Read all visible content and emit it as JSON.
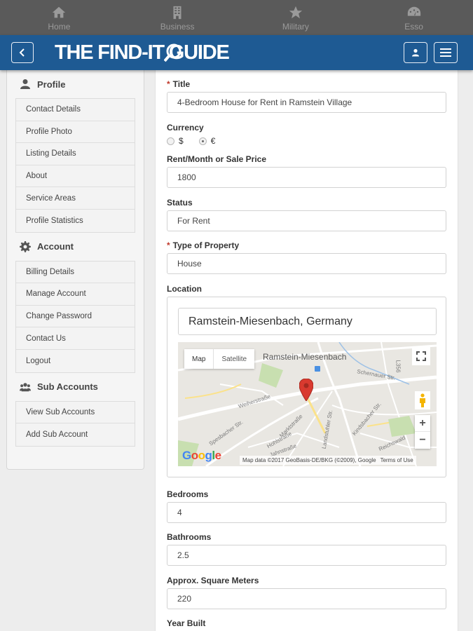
{
  "topnav": {
    "items": [
      {
        "label": "Home",
        "icon": "home-icon"
      },
      {
        "label": "Business",
        "icon": "building-icon"
      },
      {
        "label": "Military",
        "icon": "star-icon"
      },
      {
        "label": "Esso",
        "icon": "gauge-icon"
      }
    ]
  },
  "header": {
    "logo_text": "THE FIND-IT GUIDE",
    "brand_color": "#1e5a93"
  },
  "sidebar": {
    "sections": [
      {
        "title": "Profile",
        "icon": "user-icon",
        "items": [
          "Contact Details",
          "Profile Photo",
          "Listing Details",
          "About",
          "Service Areas",
          "Profile Statistics"
        ]
      },
      {
        "title": "Account",
        "icon": "gear-icon",
        "items": [
          "Billing Details",
          "Manage Account",
          "Change Password",
          "Contact Us",
          "Logout"
        ]
      },
      {
        "title": "Sub Accounts",
        "icon": "users-icon",
        "items": [
          "View Sub Accounts",
          "Add Sub Account"
        ]
      }
    ]
  },
  "form": {
    "title_label": "Title",
    "title_value": "4-Bedroom House for Rent in Ramstein Village",
    "currency_label": "Currency",
    "currency_options": [
      "$",
      "€"
    ],
    "currency_selected": "€",
    "price_label": "Rent/Month or Sale Price",
    "price_value": "1800",
    "status_label": "Status",
    "status_value": "For Rent",
    "type_label": "Type of Property",
    "type_value": "House",
    "location_label": "Location",
    "location_value": "Ramstein-Miesenbach, Germany",
    "bedrooms_label": "Bedrooms",
    "bedrooms_value": "4",
    "bathrooms_label": "Bathrooms",
    "bathrooms_value": "2.5",
    "sqm_label": "Approx. Square Meters",
    "sqm_value": "220",
    "year_label": "Year Built",
    "required_mark": "*"
  },
  "map": {
    "tab_map": "Map",
    "tab_satellite": "Satellite",
    "town_label": "Ramstein-Miesenbach",
    "google": "Google",
    "attribution": "Map data ©2017 GeoBasis-DE/BKG (©2009), Google",
    "terms": "Terms of Use",
    "zoom_in": "+",
    "zoom_out": "−",
    "streets": [
      "Weiherstraße",
      "Spesbacher Str.",
      "Marktstraße",
      "Landstuhler Str.",
      "Kindsbacher Str.",
      "Schernauer Str.",
      "L356",
      "Jahnstraße",
      "Hohlstraße",
      "Reichswald"
    ],
    "pin_color": "#d93a2f"
  }
}
